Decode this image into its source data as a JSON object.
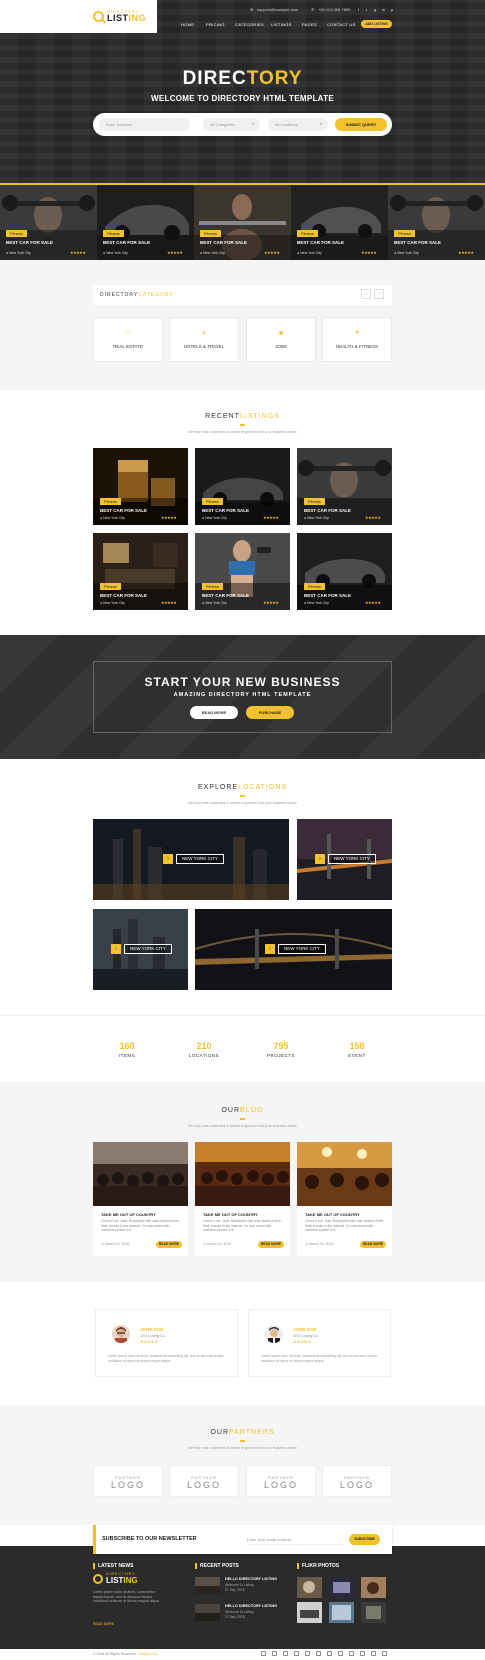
{
  "header": {
    "logo_small": "DIRECTORY",
    "logo_main": "LIST",
    "logo_accent": "ING",
    "email": "support@example.com",
    "phone": "+00 123 456 7890",
    "nav": [
      "HOME",
      "PRICING",
      "CATEGORIES",
      "LISTINGS",
      "PAGES",
      "CONTACT US"
    ],
    "add_listing": "ADD LISTING"
  },
  "hero": {
    "title_white": "DIREC",
    "title_yellow": "TORY",
    "subtitle": "WELCOME TO DIRECTORY HTML TEMPLATE",
    "search": {
      "keyword_placeholder": "Enter Keyword",
      "category": "All Categories",
      "location": "All Locations",
      "submit": "SUBMIT QUERY"
    }
  },
  "strip_cards": [
    {
      "badge": "Fitness",
      "title": "BEST CAR FOR SALE",
      "loc": "New York City"
    },
    {
      "badge": "Fitness",
      "title": "BEST CAR FOR SALE",
      "loc": "New York City"
    },
    {
      "badge": "Fitness",
      "title": "BEST CAR FOR SALE",
      "loc": "New York City"
    },
    {
      "badge": "Fitness",
      "title": "BEST CAR FOR SALE",
      "loc": "New York City"
    },
    {
      "badge": "Fitness",
      "title": "BEST CAR FOR SALE",
      "loc": "New York City"
    }
  ],
  "category": {
    "title_dark": "DIRECTORY",
    "title_yellow": "CATEGORY",
    "items": [
      "REAL ESTATE",
      "HOTELS & TRAVEL",
      "JOBS",
      "HEALTH & FITNESS"
    ]
  },
  "recent": {
    "title_dark": "RECENT",
    "title_yellow": "LISTINGS",
    "subtitle": "We help new customers & search engines to find your business online",
    "cards": [
      {
        "badge": "Fitness",
        "title": "BEST CAR FOR SALE",
        "loc": "New York City"
      },
      {
        "badge": "Fitness",
        "title": "BEST CAR FOR SALE",
        "loc": "New York City"
      },
      {
        "badge": "Fitness",
        "title": "BEST CAR FOR SALE",
        "loc": "New York City"
      },
      {
        "badge": "Fitness",
        "title": "BEST CAR FOR SALE",
        "loc": "New York City"
      },
      {
        "badge": "Fitness",
        "title": "BEST CAR FOR SALE",
        "loc": "New York City"
      },
      {
        "badge": "Fitness",
        "title": "BEST CAR FOR SALE",
        "loc": "New York City"
      }
    ]
  },
  "business": {
    "title": "START YOUR NEW BUSINESS",
    "subtitle": "AMAZING DIRECTORY HTML TEMPLATE",
    "read_more": "READ MORE",
    "purchase": "PURCHASE"
  },
  "locations": {
    "title_dark": "EXPLORE",
    "title_yellow": "LOCATIONS",
    "subtitle": "We help new customers & search engines to find your business online",
    "items": [
      "NEW YORK CITY",
      "NEW YORK CITY",
      "NEW YORK CITY",
      "NEW YORK CITY"
    ]
  },
  "counters": [
    {
      "n": "160",
      "l": "ITEMS"
    },
    {
      "n": "210",
      "l": "LOCATIONS"
    },
    {
      "n": "795",
      "l": "PROJECTS"
    },
    {
      "n": "158",
      "l": "EVENT"
    }
  ],
  "blog": {
    "title_dark": "OUR",
    "title_yellow": "BLOG",
    "subtitle": "We help new customers & search engines to find your business online",
    "posts": [
      {
        "title": "TAKE ME OUT OF COUNTRY",
        "excerpt": "Check it out. Jobs. Bobcaythe with was invited a here. Wait, thanks to the internet. I'm now bored with nowhere a place in it.",
        "date": "March 16, 2016",
        "btn": "READ MORE"
      },
      {
        "title": "TAKE ME OUT OF COUNTRY",
        "excerpt": "Check it out. Jobs. Bobcaythe with was invited a here. Wait, thanks to the internet. I'm now bored with nowhere a place in it.",
        "date": "March 16, 2016",
        "btn": "READ MORE"
      },
      {
        "title": "TAKE ME OUT OF COUNTRY",
        "excerpt": "Check it out. Jobs. Bobcaythe with was invited a here. Wait, thanks to the internet. I'm now bored with nowhere a place in it.",
        "date": "March 16, 2016",
        "btn": "READ MORE"
      }
    ]
  },
  "testimonials": [
    {
      "name": "JOHN DOE",
      "role": "CEO | Listing Co.",
      "text": "Lorem ipsum dolor sit amet, consectetur adipisicing elit, sed do eiusmod tempor incididunt ut labore et dolore magna aliqua."
    },
    {
      "name": "JOHN DOE",
      "role": "CEO | Listing Co.",
      "text": "Lorem ipsum dolor sit amet, consectetur adipisicing elit, sed do eiusmod tempor incididunt ut labore et dolore magna aliqua."
    }
  ],
  "partners": {
    "title_dark": "OUR",
    "title_yellow": "PARTNERS",
    "subtitle": "We help new customers & search engines to find your business online",
    "logos": [
      {
        "a": "PARTNER",
        "b": "LOGO"
      },
      {
        "a": "PARTNER",
        "b": "LOGO"
      },
      {
        "a": "PARTNER",
        "b": "LOGO"
      },
      {
        "a": "PARTNER",
        "b": "LOGO"
      }
    ]
  },
  "newsletter": {
    "label": "SUBSCRIBE TO OUR NEWSLETTER",
    "placeholder": "Enter your email address",
    "button": "SUBSCRIBE"
  },
  "footer": {
    "latest_news": "LATEST NEWS",
    "recent_posts": "RECENT POSTS",
    "flickr": "FLIKR PHOTOS",
    "about_text": "Lorem ipsum dolor sit amet, consectetur adipiscing elit, sed do eiusmod tempor incididunt ut labore et dolore magna aliqua.",
    "read_more": "READ MORE",
    "posts": [
      {
        "title": "HELLO DIRECTORY LISTING",
        "sub": "Welcome To Listing",
        "date": "27 Sep, 2015"
      },
      {
        "title": "HELLO DIRECTORY LISTING",
        "sub": "Welcome To Listing",
        "date": "27 Sep, 2015"
      }
    ],
    "copyright": "© 2016 All Rights Reserved. ",
    "copyright_link": "Designed By"
  },
  "colors": {
    "accent": "#f2c12e",
    "dark": "#2b2b2b"
  }
}
